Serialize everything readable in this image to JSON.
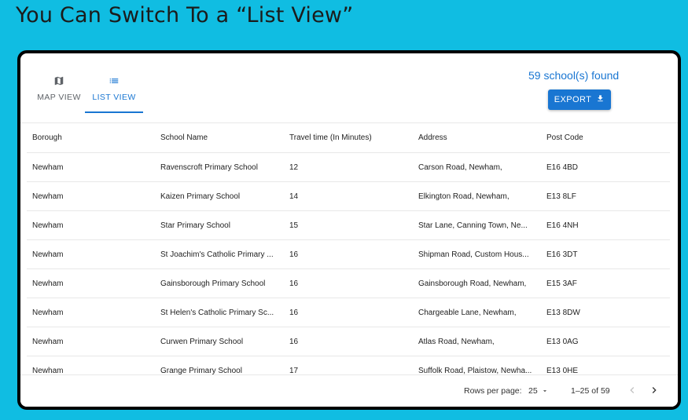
{
  "slide_title": "You Can Switch To a “List View”",
  "tabs": [
    {
      "label": "MAP VIEW",
      "icon": "map-icon"
    },
    {
      "label": "LIST VIEW",
      "icon": "list-icon",
      "active": true
    }
  ],
  "results_count": "59 school(s) found",
  "export_label": "EXPORT",
  "accent_color": "#1976d2",
  "table": {
    "headers": [
      "Borough",
      "School Name",
      "Travel time (In Minutes)",
      "Address",
      "Post Code"
    ],
    "rows": [
      [
        "Newham",
        "Ravenscroft Primary School",
        "12",
        "Carson Road, Newham,",
        "E16 4BD"
      ],
      [
        "Newham",
        "Kaizen Primary School",
        "14",
        "Elkington Road, Newham,",
        "E13 8LF"
      ],
      [
        "Newham",
        "Star Primary School",
        "15",
        "Star Lane, Canning Town, Ne...",
        "E16 4NH"
      ],
      [
        "Newham",
        "St Joachim's Catholic Primary ...",
        "16",
        "Shipman Road, Custom Hous...",
        "E16 3DT"
      ],
      [
        "Newham",
        "Gainsborough Primary School",
        "16",
        "Gainsborough Road, Newham,",
        "E15 3AF"
      ],
      [
        "Newham",
        "St Helen's Catholic Primary Sc...",
        "16",
        "Chargeable Lane, Newham,",
        "E13 8DW"
      ],
      [
        "Newham",
        "Curwen Primary School",
        "16",
        "Atlas Road, Newham,",
        "E13 0AG"
      ],
      [
        "Newham",
        "Grange Primary School",
        "17",
        "Suffolk Road, Plaistow, Newha...",
        "E13 0HE"
      ]
    ]
  },
  "pagination": {
    "rows_per_page_label": "Rows per page:",
    "rows_per_page_value": "25",
    "range": "1–25 of 59"
  }
}
